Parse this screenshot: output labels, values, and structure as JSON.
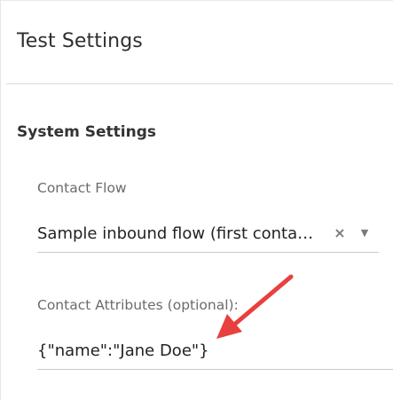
{
  "panel": {
    "title": "Test Settings"
  },
  "system_settings": {
    "heading": "System Settings",
    "contact_flow": {
      "label": "Contact Flow",
      "selected_value": "Sample inbound flow (first contact experience)",
      "clear_glyph": "×",
      "caret_glyph": "▼"
    },
    "contact_attributes": {
      "label": "Contact Attributes (optional):",
      "value": "{\"name\":\"Jane Doe\"}"
    }
  },
  "annotation": {
    "arrow_color": "#e8403f",
    "arrow_icon": "callout-arrow-icon"
  }
}
